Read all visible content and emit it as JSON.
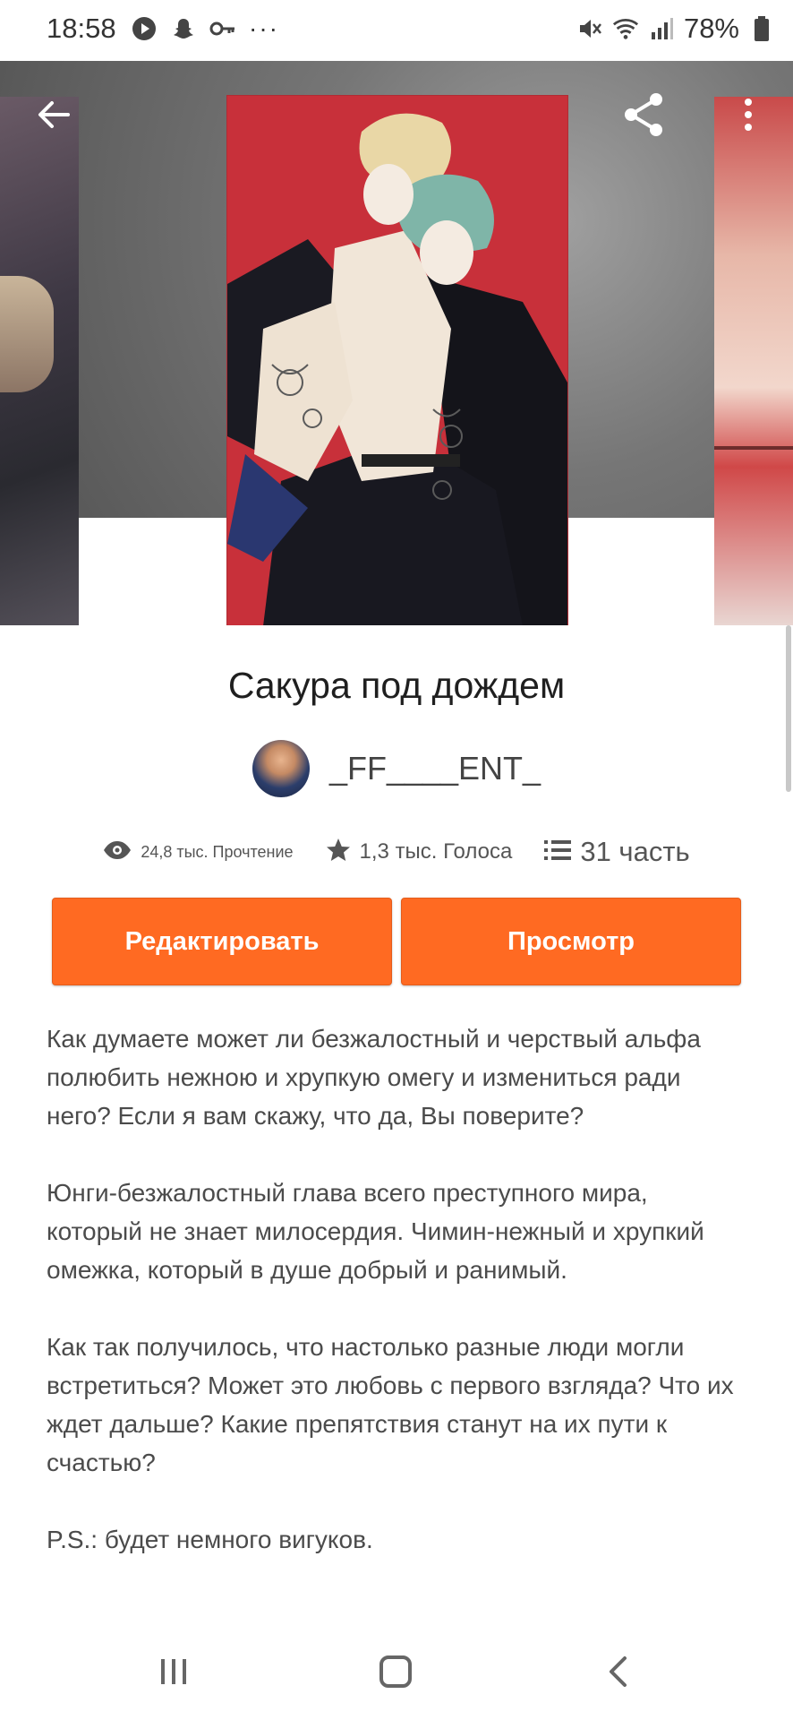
{
  "status_bar": {
    "time": "18:58",
    "battery": "78%",
    "more": "···"
  },
  "header": {
    "icons": [
      "back-arrow-icon",
      "share-icon",
      "more-vertical-icon"
    ]
  },
  "story": {
    "title": "Сакура под дождем",
    "author": "_FF____ENT_",
    "stats": {
      "reads": "24,8 тыс. Прочтение",
      "votes": "1,3 тыс. Голоса",
      "parts": "31 часть"
    }
  },
  "actions": {
    "edit_label": "Редактировать",
    "view_label": "Просмотр"
  },
  "description": {
    "paragraphs": [
      "Как думаете может ли безжалостный и черствый альфа полюбить нежною и хрупкую омегу и измениться ради него? Если я вам скажу, что да, Вы поверите?",
      "Юнги-безжалостный глава всего преступного мира, который не знает милосердия. Чимин-нежный и хрупкий омежка, который в душе добрый и ранимый.",
      "Как так получилось, что настолько разные люди могли встретиться? Может это любовь с первого взгляда? Что их ждет дальше? Какие препятствия станут на их пути к счастью?",
      "P.S.: будет немного вигуков."
    ]
  },
  "colors": {
    "accent": "#ff6a22",
    "cover_red": "#c8303a"
  }
}
